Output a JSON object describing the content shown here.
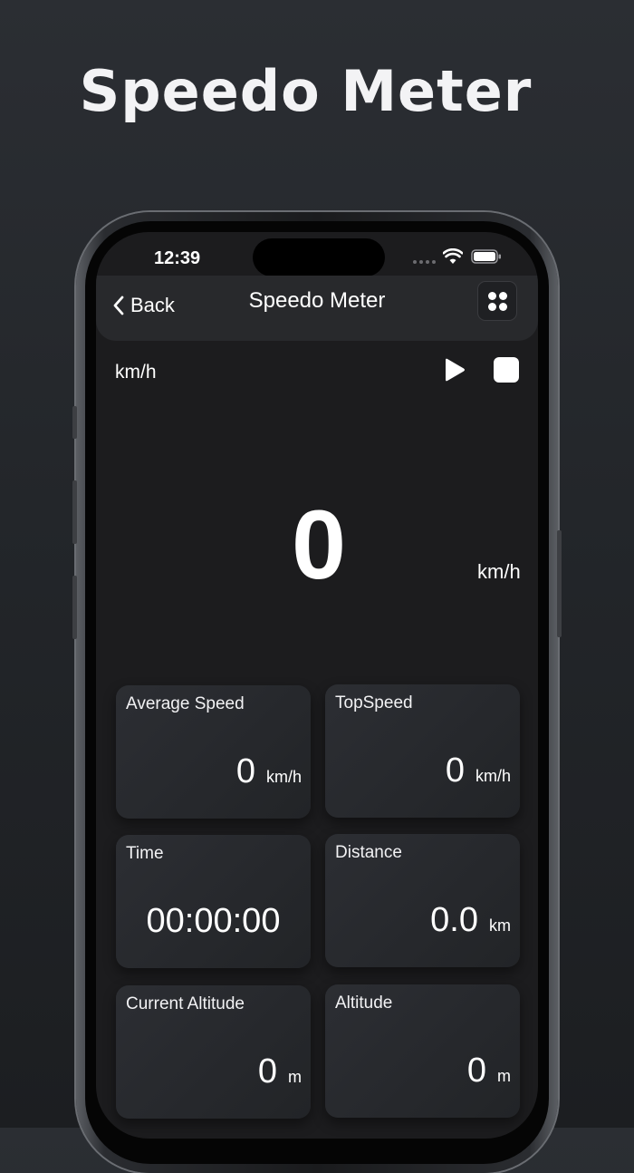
{
  "promo": {
    "title": "Speedo Meter"
  },
  "status_bar": {
    "time": "12:39"
  },
  "nav": {
    "back_label": "Back",
    "title": "Speedo Meter"
  },
  "controls": {
    "unit_label": "km/h"
  },
  "speed": {
    "value": "0",
    "unit": "km/h"
  },
  "cards": {
    "average_speed": {
      "label": "Average Speed",
      "value": "0",
      "unit": "km/h"
    },
    "top_speed": {
      "label": "TopSpeed",
      "value": "0",
      "unit": "km/h"
    },
    "time": {
      "label": "Time",
      "value": "00:00:00"
    },
    "distance": {
      "label": "Distance",
      "value": "0.0",
      "unit": "km"
    },
    "current_altitude": {
      "label": "Current Altitude",
      "value": "0",
      "unit": "m"
    },
    "altitude": {
      "label": "Altitude",
      "value": "0",
      "unit": "m"
    }
  },
  "icons": {
    "back": "chevron-left-icon",
    "menu": "grid-icon",
    "play": "play-icon",
    "stop": "stop-icon",
    "wifi": "wifi-icon",
    "battery": "battery-icon"
  }
}
